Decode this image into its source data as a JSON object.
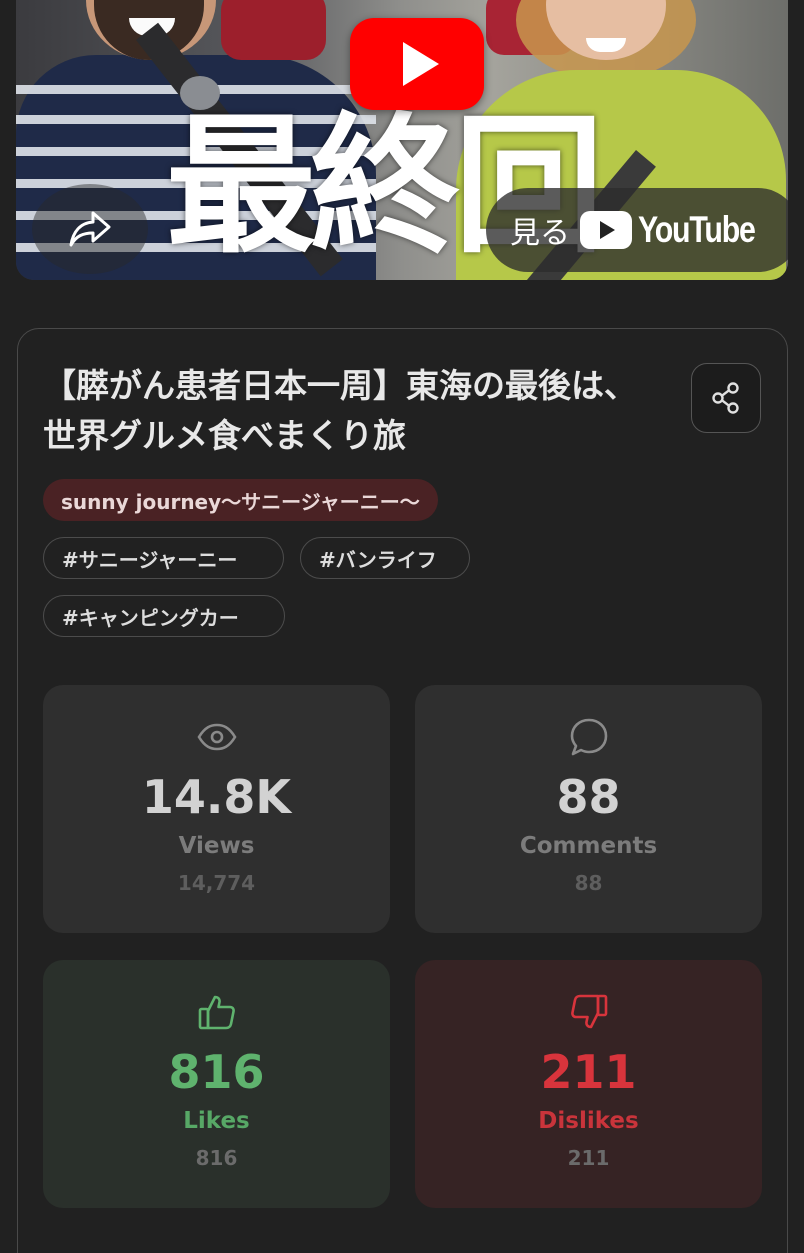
{
  "player": {
    "thumbnail_overlay_text": "最終回",
    "watch_label": "見る",
    "youtube_wordmark": "YouTube",
    "play_button_color": "#ff0000"
  },
  "video": {
    "title": "【膵がん患者日本一周】東海の最後は、世界グルメ食べまくり旅",
    "channel": "sunny journey〜サニージャーニー〜",
    "tags": [
      "#サニージャーニー",
      "#バンライフ",
      "#キャンピングカー"
    ]
  },
  "stats": {
    "views": {
      "short": "14.8K",
      "label": "Views",
      "exact": "14,774",
      "icon": "eye-icon"
    },
    "comments": {
      "short": "88",
      "label": "Comments",
      "exact": "88",
      "icon": "speech-bubble-icon"
    },
    "likes": {
      "short": "816",
      "label": "Likes",
      "exact": "816",
      "icon": "thumbs-up-icon",
      "color": "#5fb36e"
    },
    "dislikes": {
      "short": "211",
      "label": "Dislikes",
      "exact": "211",
      "icon": "thumbs-down-icon",
      "color": "#d8343c"
    }
  }
}
